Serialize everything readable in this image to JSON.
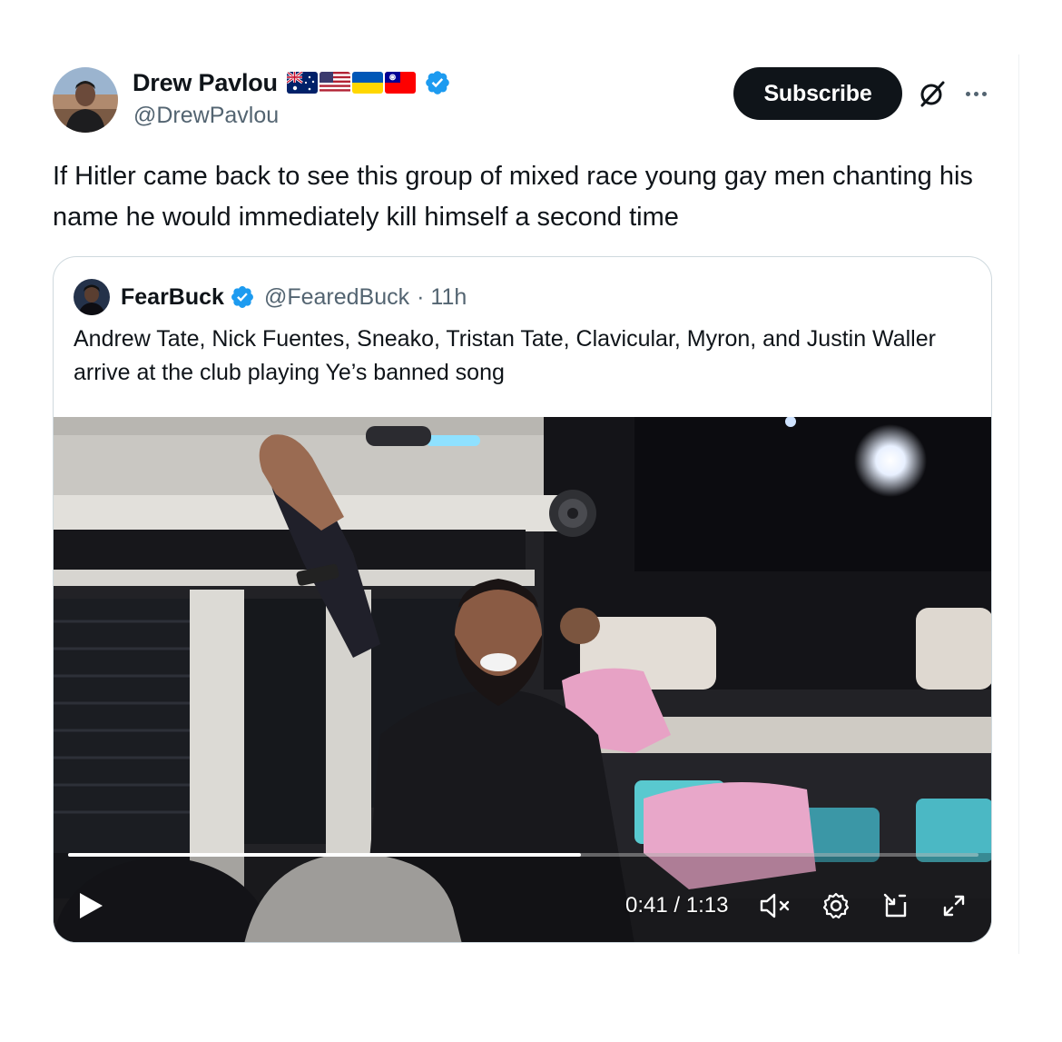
{
  "post": {
    "author": {
      "name": "Drew Pavlou",
      "handle": "@DrewPavlou",
      "flags": [
        "australia-flag",
        "united-states-flag",
        "ukraine-flag",
        "taiwan-flag"
      ],
      "verified": true
    },
    "subscribe_label": "Subscribe",
    "text": "If Hitler came back to see this group of mixed race young gay men chanting his name he would immediately kill himself a second time"
  },
  "quoted": {
    "author": {
      "name": "FearBuck",
      "handle": "@FearedBuck",
      "time": "· 11h",
      "verified": true
    },
    "text": "Andrew Tate, Nick Fuentes, Sneako, Tristan Tate, Clavicular, Myron, and Justin Waller arrive at the club playing Ye’s banned song",
    "video": {
      "time_label": "0:41 / 1:13",
      "progress_fraction": 0.563,
      "muted": true
    }
  },
  "colors": {
    "text_primary": "#0f1419",
    "text_secondary": "#536471",
    "verified_blue": "#1d9bf0",
    "border": "#cfd9de"
  }
}
